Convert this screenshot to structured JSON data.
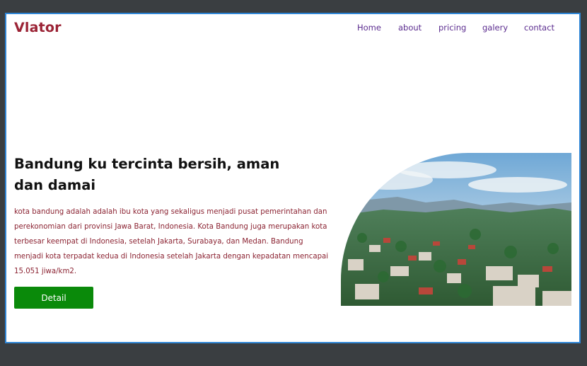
{
  "brand": {
    "logo": "Vlator"
  },
  "nav": {
    "items": [
      "Home",
      "about",
      "pricing",
      "galery",
      "contact"
    ]
  },
  "hero": {
    "headline": "Bandung ku tercinta bersih, aman dan damai",
    "description": "kota bandung adalah adalah ibu kota yang sekaligus menjadi pusat pemerintahan dan perekonomian dari provinsi Jawa Barat, Indonesia. Kota Bandung juga merupakan kota terbesar keempat di Indonesia, setelah Jakarta, Surabaya, dan Medan. Bandung menjadi kota terpadat kedua di Indonesia setelah Jakarta dengan kepadatan mencapai 15.051 jiwa/km2.",
    "button_label": "Detail",
    "image": "bandung-city-aerial-photo"
  },
  "colors": {
    "logo": "#9b2335",
    "nav_link": "#5b2c8f",
    "description_text": "#8b2332",
    "button": "#0a8a0a",
    "frame_border": "#2f86d6",
    "background": "#3a3e41"
  }
}
